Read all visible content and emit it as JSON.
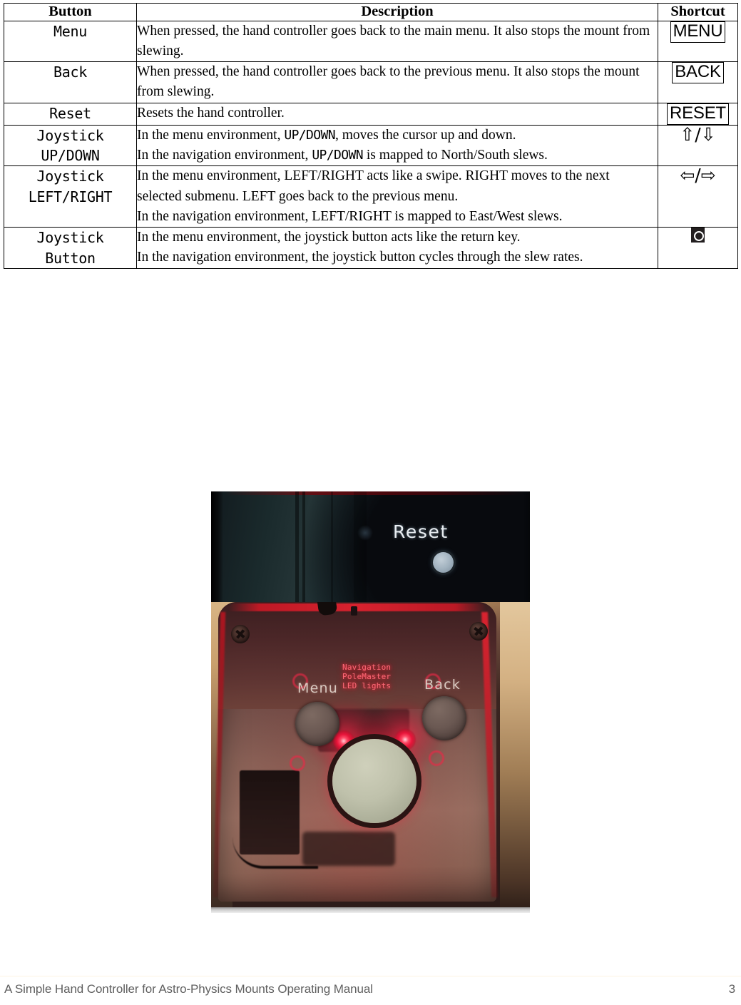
{
  "table": {
    "headers": [
      "Button",
      "Description",
      "Shortcut"
    ],
    "rows": [
      {
        "button": "Menu",
        "description_html": "When pressed, the hand controller goes back to the main menu. It also stops the mount from slewing.",
        "shortcut_kind": "keycap",
        "shortcut": "MENU"
      },
      {
        "button": "Back",
        "description_html": "When pressed, the hand controller goes back to the previous menu. It also stops the mount from slewing.",
        "shortcut_kind": "keycap",
        "shortcut": "BACK"
      },
      {
        "button": "Reset",
        "description_html": "Resets the hand controller.",
        "shortcut_kind": "keycap",
        "shortcut": "RESET"
      },
      {
        "button": "Joystick\nUP/DOWN",
        "description_line1_a": "In the menu environment, ",
        "description_line1_mono": "UP/DOWN",
        "description_line1_b": ", moves the cursor up and down.",
        "description_line2_a": "In the navigation environment, ",
        "description_line2_mono": "UP/DOWN",
        "description_line2_b": " is mapped to North/South slews.",
        "shortcut_kind": "arrows",
        "shortcut": "⇧/⇩"
      },
      {
        "button": "Joystick\nLEFT/RIGHT",
        "description_para1": "In the menu environment, LEFT/RIGHT acts like a swipe. RIGHT moves to the next selected submenu. LEFT goes back to the previous menu.",
        "description_para2": "In the navigation environment, LEFT/RIGHT is mapped to East/West slews.",
        "shortcut_kind": "arrows",
        "shortcut": "⇦/⇨"
      },
      {
        "button": "Joystick\nButton",
        "description_para1": "In the menu environment, the joystick button acts like the return key.",
        "description_para2": "In the navigation environment, the joystick button cycles through the slew rates.",
        "shortcut_kind": "glyph",
        "shortcut": "joystick-button-glyph"
      }
    ]
  },
  "photo": {
    "top_panel": {
      "reset_label": "Reset",
      "reset_button": "reset-push-button"
    },
    "controller": {
      "menu_label": "Menu",
      "back_label": "Back",
      "led_annotation": "Navigation\nPoleMaster\nLED lights"
    }
  },
  "footer": {
    "title": "A Simple Hand Controller for Astro-Physics Mounts Operating Manual",
    "page": "3"
  }
}
